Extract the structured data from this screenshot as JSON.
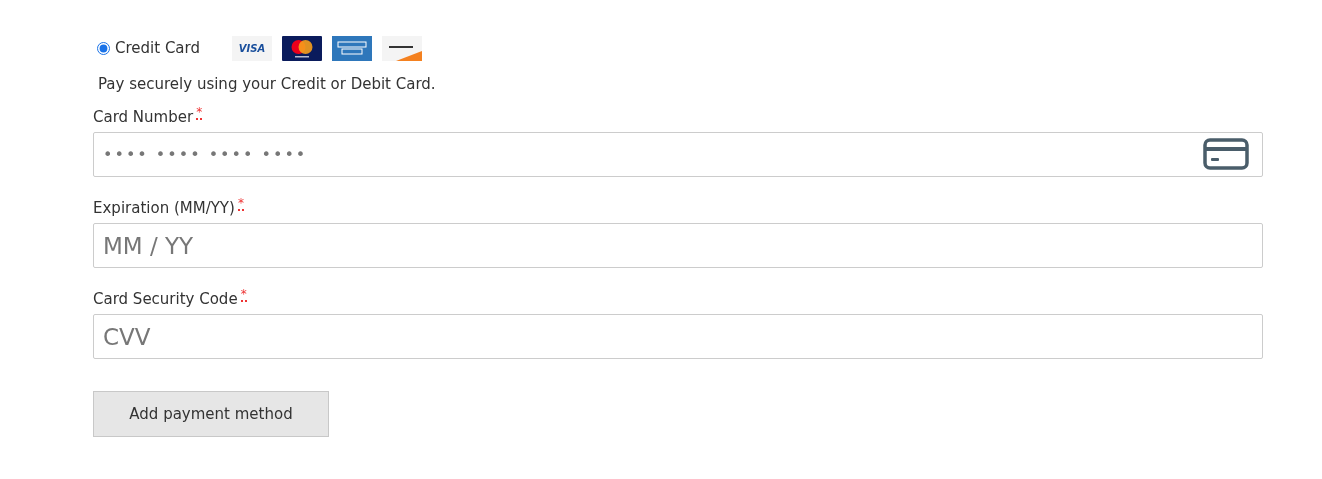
{
  "payment_option": {
    "label": "Credit Card",
    "selected": true
  },
  "card_brands": [
    {
      "kind": "visa",
      "label": "VISA"
    },
    {
      "kind": "mastercard"
    },
    {
      "kind": "amex"
    },
    {
      "kind": "discover"
    }
  ],
  "description": "Pay securely using your Credit or Debit Card.",
  "fields": [
    {
      "label": "Card Number",
      "required_mark": "*",
      "placeholder": "•••• •••• •••• ••••",
      "kind": "card"
    },
    {
      "label": "Expiration (MM/YY)",
      "required_mark": "*",
      "placeholder": "MM / YY",
      "kind": "text"
    },
    {
      "label": "Card Security Code",
      "required_mark": "*",
      "placeholder": "CVV",
      "kind": "text"
    }
  ],
  "submit_button": "Add payment method"
}
